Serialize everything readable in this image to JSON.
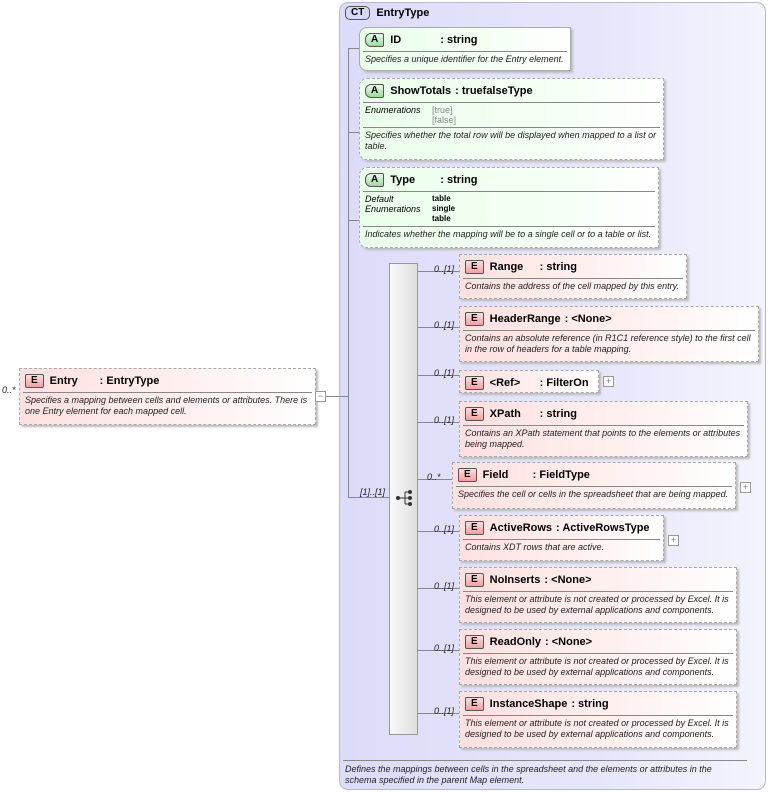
{
  "complex_type": {
    "badge": "CT",
    "name": "EntryType",
    "documentation": "Defines the mappings between cells in the spreadsheet and the elements or attributes in the schema specified in the parent Map element."
  },
  "root": {
    "badge": "E",
    "name": "Entry",
    "type": ": EntryType",
    "cardinality": "0..*",
    "documentation": "Specifies a mapping between cells and elements or attributes. There is one Entry element for each mapped cell.",
    "collapse_symbol": "−"
  },
  "attributes": [
    {
      "badge": "A",
      "name": "ID",
      "type": ": string",
      "documentation": "Specifies a unique identifier for the Entry element."
    },
    {
      "badge": "A",
      "name": "ShowTotals",
      "type": ": truefalseType",
      "enum_label": "Enumerations",
      "enums": [
        "[true]",
        "[false]"
      ],
      "documentation": "Specifies whether the total row will be displayed when mapped to a list or table."
    },
    {
      "badge": "A",
      "name": "Type",
      "type": ": string",
      "default_label": "Default",
      "default": "table",
      "enum_label": "Enumerations",
      "enums": [
        "single",
        "table"
      ],
      "documentation": "Indicates whether the mapping will be to a single cell or to a table or list."
    }
  ],
  "sequence": {
    "cardinality": "[1]..[1]"
  },
  "elements": [
    {
      "badge": "E",
      "name": "Range",
      "type": ": string",
      "cardinality": "0..[1]",
      "documentation": "Contains the address of the cell mapped by this entry."
    },
    {
      "badge": "E",
      "name": "HeaderRange",
      "type": ": <None>",
      "cardinality": "0..[1]",
      "documentation": "Contains an absolute reference (in R1C1 reference style) to the first cell in the row of headers for a table mapping."
    },
    {
      "badge": "E",
      "name": "<Ref>",
      "type": ": FilterOn",
      "cardinality": "0..[1]",
      "documentation": "",
      "expand": "+"
    },
    {
      "badge": "E",
      "name": "XPath",
      "type": ": string",
      "cardinality": "0..[1]",
      "documentation": "Contains an XPath statement that points to the elements or attributes being mapped."
    },
    {
      "badge": "E",
      "name": "Field",
      "type": ": FieldType",
      "cardinality": "0..*",
      "documentation": "Specifies the cell or cells in the spreadsheet that are being mapped.",
      "expand": "+"
    },
    {
      "badge": "E",
      "name": "ActiveRows",
      "type": ": ActiveRowsType",
      "cardinality": "0..[1]",
      "documentation": "Contains XDT rows that are active.",
      "expand": "+"
    },
    {
      "badge": "E",
      "name": "NoInserts",
      "type": ": <None>",
      "cardinality": "0..[1]",
      "documentation": "This element or attribute is not created or processed by Excel. It is designed to be used by external applications and components."
    },
    {
      "badge": "E",
      "name": "ReadOnly",
      "type": ": <None>",
      "cardinality": "0..[1]",
      "documentation": "This element or attribute is not created or processed by Excel. It is designed to be used by external applications and components."
    },
    {
      "badge": "E",
      "name": "InstanceShape",
      "type": ": string",
      "cardinality": "0..[1]",
      "documentation": "This element or attribute is not created or processed by Excel. It is designed to be used by external applications and components."
    }
  ]
}
